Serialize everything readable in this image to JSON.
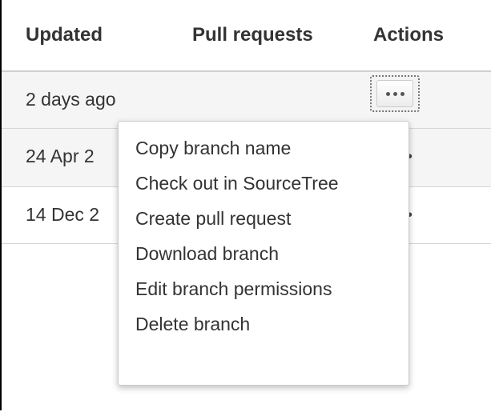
{
  "table": {
    "headers": {
      "updated": "Updated",
      "pull_requests": "Pull requests",
      "actions": "Actions"
    },
    "rows": [
      {
        "updated": "2 days ago"
      },
      {
        "updated": "24 Apr 2"
      },
      {
        "updated": "14 Dec 2"
      }
    ]
  },
  "actions_menu": {
    "button_icon": "more-icon",
    "items": [
      "Copy branch name",
      "Check out in SourceTree",
      "Create pull request",
      "Download branch",
      "Edit branch permissions",
      "Delete branch"
    ]
  }
}
